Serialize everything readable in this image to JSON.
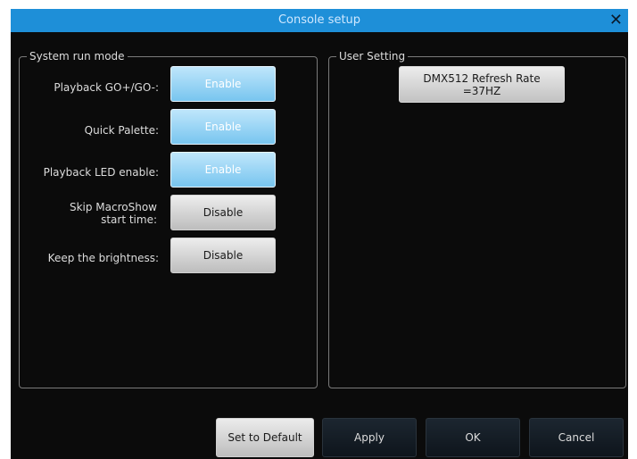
{
  "window": {
    "title": "Console setup",
    "close_glyph": "✕"
  },
  "system_run_mode": {
    "title": "System run mode",
    "rows": [
      {
        "label": "Playback GO+/GO-:",
        "value": "Enable"
      },
      {
        "label": "Quick Palette:",
        "value": "Enable"
      },
      {
        "label": "Playback LED enable:",
        "value": "Enable"
      },
      {
        "label": "Skip MacroShow\nstart time:",
        "value": "Disable"
      },
      {
        "label": "Keep the brightness:",
        "value": "Disable"
      }
    ]
  },
  "user_setting": {
    "title": "User Setting",
    "dmx_button": "DMX512 Refresh Rate\n=37HZ"
  },
  "footer": {
    "set_default": "Set to Default",
    "apply": "Apply",
    "ok": "OK",
    "cancel": "Cancel"
  },
  "colors": {
    "titlebar": "#1e8fd8",
    "enable_button": "#8fd0f3",
    "disable_button": "#d6d6d6"
  },
  "icons": {
    "close": "close-icon"
  }
}
